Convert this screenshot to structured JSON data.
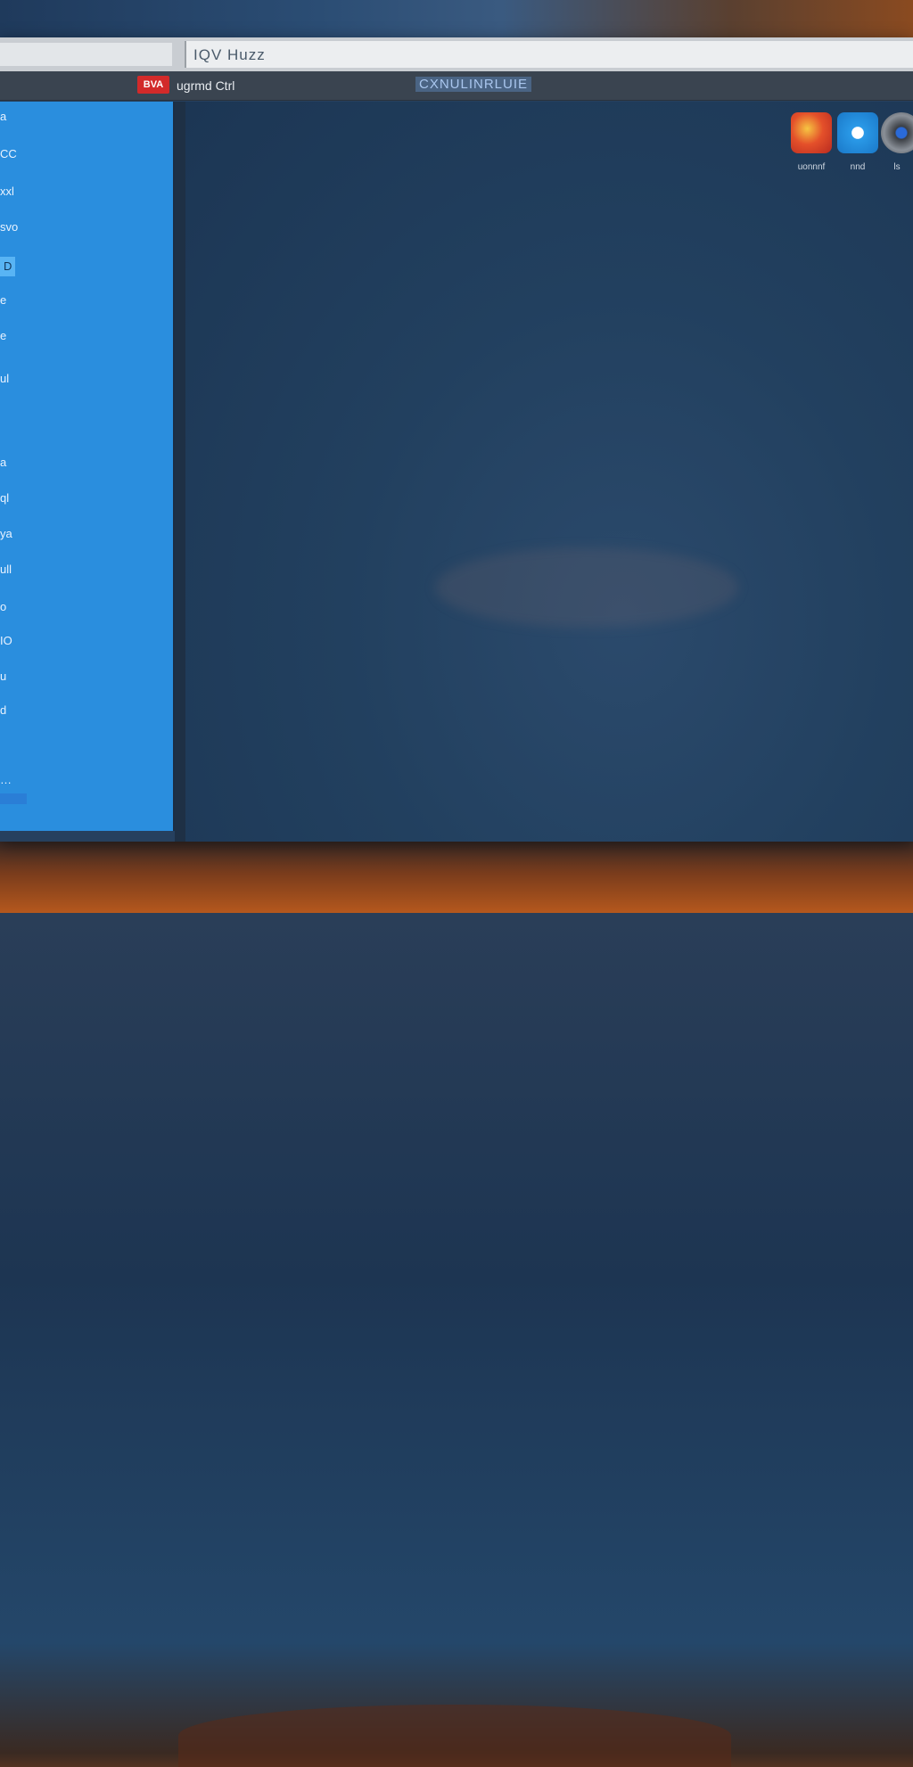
{
  "window": {
    "address_text": "IQV Huzz",
    "toolbar_badge": "BVA",
    "toolbar_label": "ugrmd Ctrl",
    "toolbar_title": "CXNULINRLUIE"
  },
  "sidebar": {
    "items": [
      {
        "label": "a"
      },
      {
        "label": "CC"
      },
      {
        "label": "xxl"
      },
      {
        "label": "svo"
      },
      {
        "label": "D",
        "active": true
      },
      {
        "label": "e"
      },
      {
        "label": "e"
      },
      {
        "label": "ul"
      },
      {
        "label": "a"
      },
      {
        "label": "ql"
      },
      {
        "label": "ya"
      },
      {
        "label": "ull"
      },
      {
        "label": "o"
      },
      {
        "label": "IO"
      },
      {
        "label": "u"
      },
      {
        "label": "d"
      },
      {
        "label": "…"
      }
    ]
  },
  "desktop": {
    "icons": [
      {
        "name": "media-app-icon",
        "label": "uonnnf",
        "color": "#d83a2a"
      },
      {
        "name": "cloud-app-icon",
        "label": "nnd",
        "color": "#2a9ae8"
      },
      {
        "name": "settings-app-icon",
        "label": "ls",
        "color": "#5a6068"
      }
    ]
  }
}
